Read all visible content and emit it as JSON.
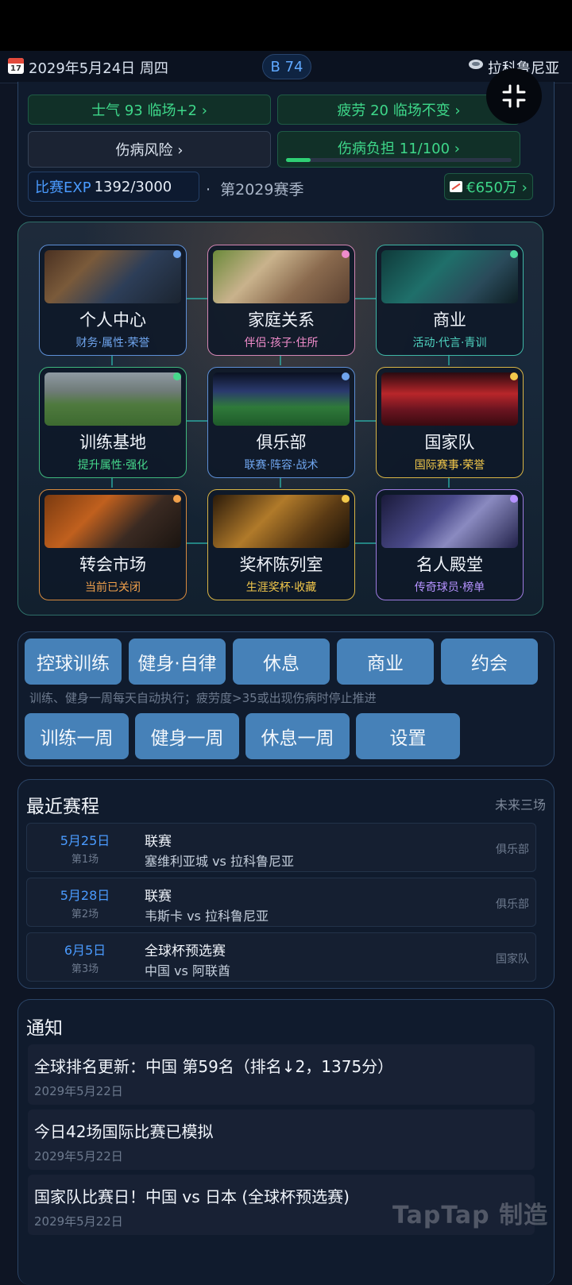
{
  "topbar": {
    "calendar_day": "17",
    "date": "2029年5月24日 周四",
    "rating_badge": "B 74",
    "team": "拉科鲁尼亚"
  },
  "status": {
    "morale": "士气 93  临场+2 ›",
    "fatigue": "疲劳 20  临场不变 ›",
    "injury_risk": "伤病风险 ›",
    "injury_load": "伤病负担 11/100 ›",
    "injury_load_fraction": 0.11,
    "exp_label": "比赛EXP",
    "exp_value": "1392/3000",
    "season": "第2029赛季",
    "money": "€650万 ›"
  },
  "hub": {
    "cards": [
      {
        "title": "个人中心",
        "sub": "财务·属性·荣誉",
        "color": "#5d8fd6",
        "sub_color": "#6fa5ee",
        "dot": "#6fa5ee"
      },
      {
        "title": "家庭关系",
        "sub": "伴侣·孩子·住所",
        "color": "#d486b4",
        "sub_color": "#f08ccb",
        "dot": "#f08ccb"
      },
      {
        "title": "商业",
        "sub": "活动·代言·青训",
        "color": "#3eb6a6",
        "sub_color": "#4fd3c0",
        "dot": "#4fd79f"
      },
      {
        "title": "训练基地",
        "sub": "提升属性·强化",
        "color": "#3fb77d",
        "sub_color": "#46d98c",
        "dot": "#46d98c"
      },
      {
        "title": "俱乐部",
        "sub": "联赛·阵容·战术",
        "color": "#5d8fd6",
        "sub_color": "#6fa5ee",
        "dot": "#6fa5ee"
      },
      {
        "title": "国家队",
        "sub": "国际赛事·荣誉",
        "color": "#d9b545",
        "sub_color": "#f2c84b",
        "dot": "#f2c84b"
      },
      {
        "title": "转会市场",
        "sub": "当前已关闭",
        "color": "#d88a3e",
        "sub_color": "#f0a04b",
        "dot": "#f0a04b"
      },
      {
        "title": "奖杯陈列室",
        "sub": "生涯奖杯·收藏",
        "color": "#d9b545",
        "sub_color": "#f2c84b",
        "dot": "#f2c84b"
      },
      {
        "title": "名人殿堂",
        "sub": "传奇球员·榜单",
        "color": "#9d7be0",
        "sub_color": "#b592ff",
        "dot": "#b592ff"
      }
    ]
  },
  "actions": {
    "row1": [
      "控球训练",
      "健身·自律",
      "休息",
      "商业",
      "约会"
    ],
    "hint": "训练、健身一周每天自动执行；疲劳度>35或出现伤病时停止推进",
    "row2": [
      "训练一周",
      "健身一周",
      "休息一周",
      "设置"
    ]
  },
  "schedule": {
    "title": "最近赛程",
    "subtitle": "未来三场",
    "matches": [
      {
        "date": "5月25日",
        "round": "第1场",
        "competition": "联赛",
        "teams": "塞维利亚城  vs  拉科鲁尼亚",
        "type": "俱乐部"
      },
      {
        "date": "5月28日",
        "round": "第2场",
        "competition": "联赛",
        "teams": "韦斯卡  vs  拉科鲁尼亚",
        "type": "俱乐部"
      },
      {
        "date": "6月5日",
        "round": "第3场",
        "competition": "全球杯预选赛",
        "teams": "中国  vs  阿联酋",
        "type": "国家队"
      }
    ]
  },
  "notices": {
    "title": "通知",
    "items": [
      {
        "text": "全球排名更新：中国 第59名（排名↓2，1375分）",
        "date": "2029年5月22日"
      },
      {
        "text": "今日42场国际比赛已模拟",
        "date": "2029年5月22日"
      },
      {
        "text": "国家队比赛日！中国 vs 日本 (全球杯预选赛)",
        "date": "2029年5月22日"
      }
    ]
  },
  "watermark": "TapTap 制造"
}
